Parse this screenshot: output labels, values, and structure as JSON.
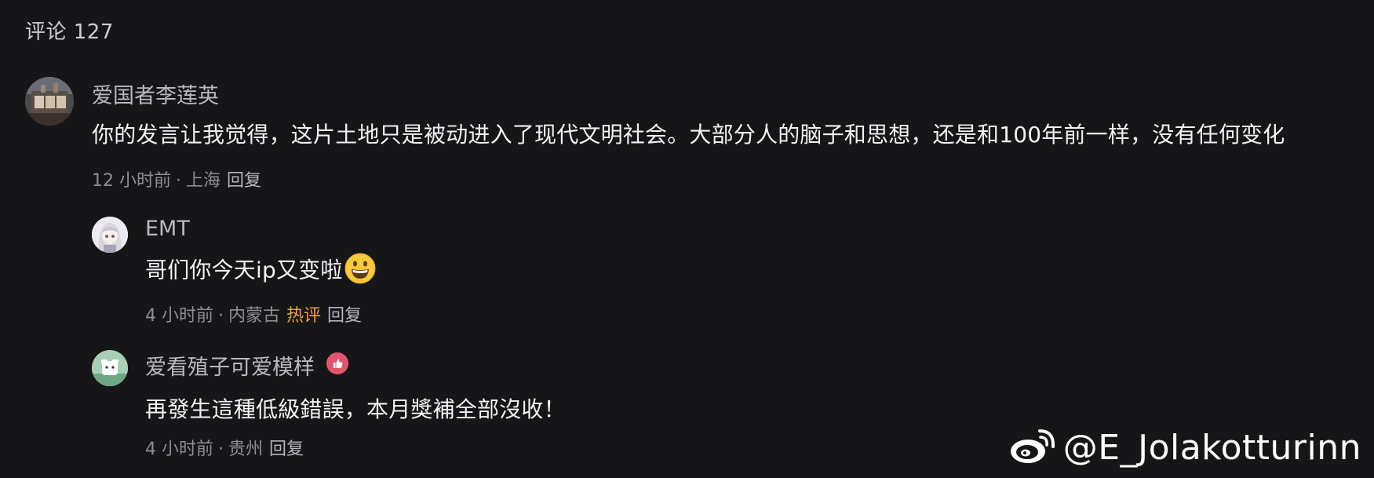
{
  "header": {
    "title": "评论 127"
  },
  "comments": [
    {
      "username": "爱国者李莲英",
      "text": "你的发言让我觉得，这片土地只是被动进入了现代文明社会。大部分人的脑子和思想，还是和100年前一样，没有任何变化",
      "time": "12 小时前",
      "location": "上海",
      "reply_label": "回复",
      "avatar_icon": "avatar-photo-icon"
    },
    {
      "username": "EMT",
      "text": "哥们你今天ip又变啦",
      "emoji_icon": "grinning-face-emoji",
      "time": "4 小时前",
      "location": "内蒙古",
      "hot_label": "热评",
      "reply_label": "回复",
      "avatar_icon": "anime-avatar-icon"
    },
    {
      "username": "爱看殖子可爱模样",
      "badge_icon": "like-badge-icon",
      "text": "再發生這種低級錯誤，本月獎補全部沒收！",
      "time": "4 小时前",
      "location": "贵州",
      "reply_label": "回复",
      "avatar_icon": "cartoon-avatar-icon"
    }
  ],
  "watermark": {
    "text": "@E_Jolakotturinn",
    "icon": "weibo-logo-icon"
  },
  "colors": {
    "background": "#161618",
    "hot": "#f2a23a",
    "meta": "#8e8e94"
  }
}
